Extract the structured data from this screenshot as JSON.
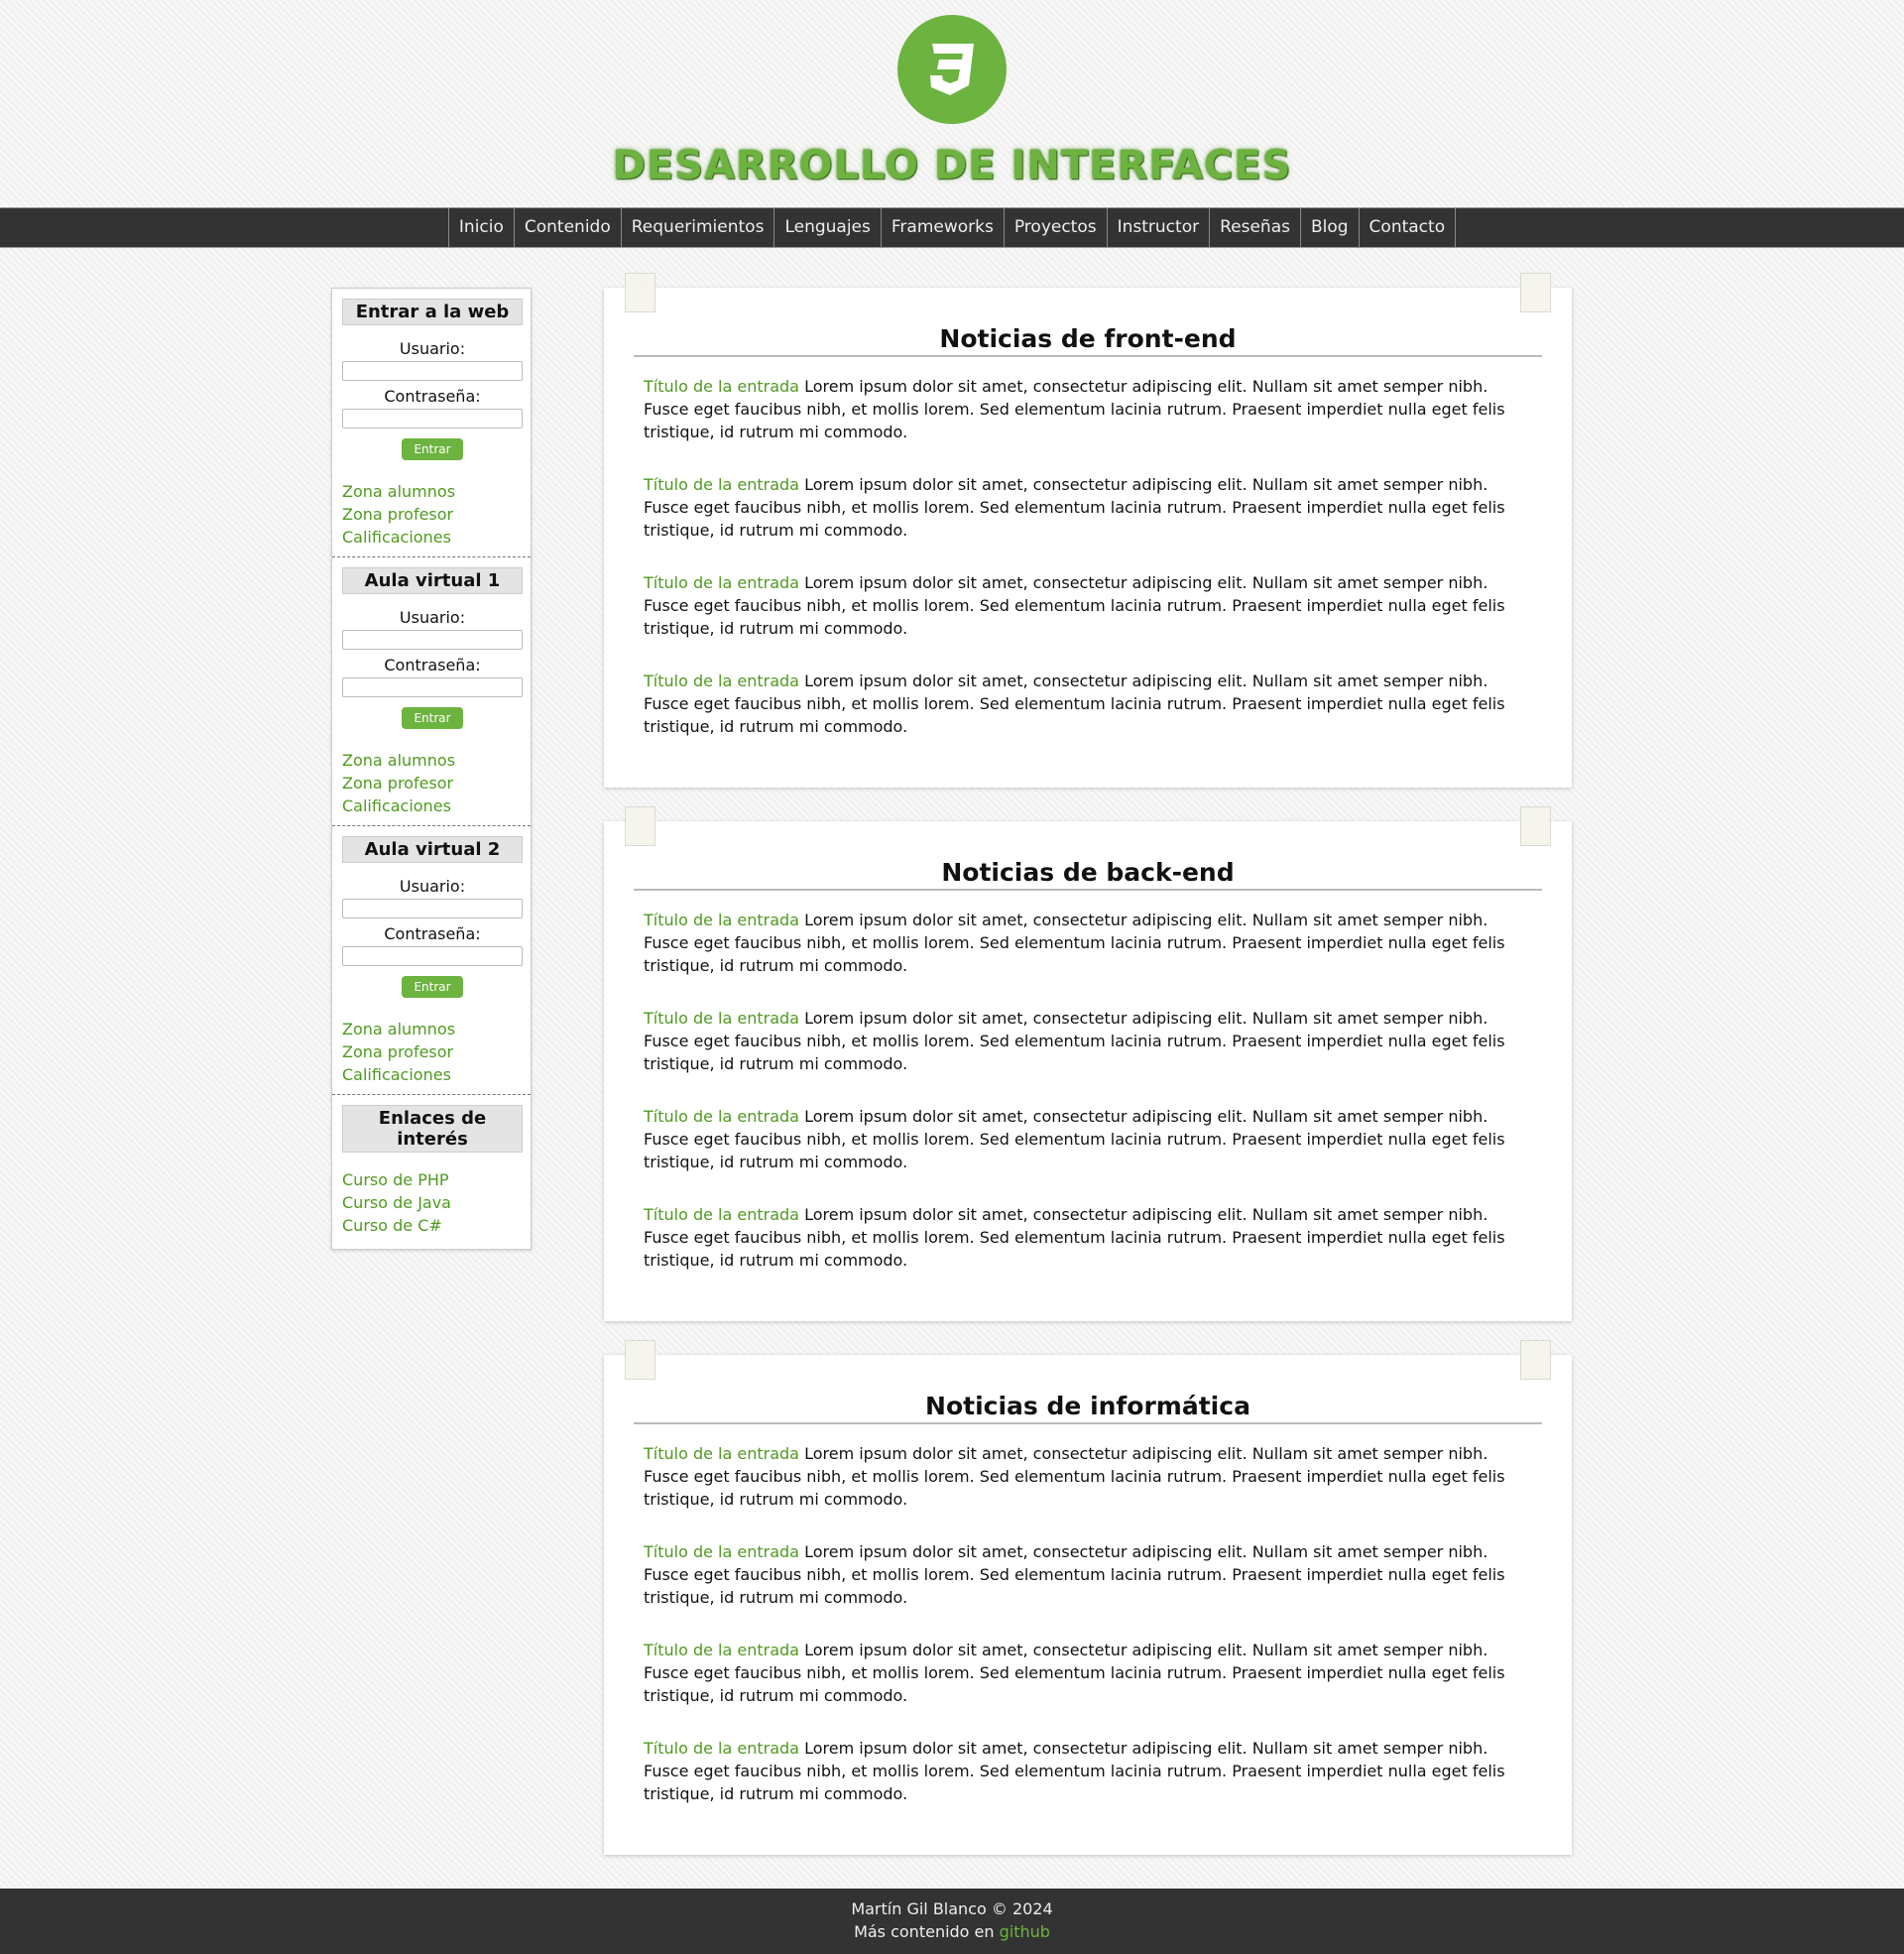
{
  "header": {
    "title": "DESARROLLO DE INTERFACES",
    "logo_icon": "css3-icon",
    "accent": "#6db33f"
  },
  "nav": [
    "Inicio",
    "Contenido",
    "Requerimientos",
    "Lenguajes",
    "Frameworks",
    "Proyectos",
    "Instructor",
    "Reseñas",
    "Blog",
    "Contacto"
  ],
  "sidebar": {
    "sections": [
      {
        "heading": "Entrar a la web",
        "user_label": "Usuario:",
        "pass_label": "Contraseña:",
        "button": "Entrar",
        "links": [
          "Zona alumnos",
          "Zona profesor",
          "Calificaciones"
        ]
      },
      {
        "heading": "Aula virtual 1",
        "user_label": "Usuario:",
        "pass_label": "Contraseña:",
        "button": "Entrar",
        "links": [
          "Zona alumnos",
          "Zona profesor",
          "Calificaciones"
        ]
      },
      {
        "heading": "Aula virtual 2",
        "user_label": "Usuario:",
        "pass_label": "Contraseña:",
        "button": "Entrar",
        "links": [
          "Zona alumnos",
          "Zona profesor",
          "Calificaciones"
        ]
      }
    ],
    "interest": {
      "heading": "Enlaces de interés",
      "links": [
        "Curso de PHP",
        "Curso de Java",
        "Curso de C#"
      ]
    }
  },
  "panels": [
    {
      "title": "Noticias de front-end",
      "entries": [
        {
          "title": "Título de la entrada",
          "text": " Lorem ipsum dolor sit amet, consectetur adipiscing elit. Nullam sit amet semper nibh. Fusce eget faucibus nibh, et mollis lorem. Sed elementum lacinia rutrum. Praesent imperdiet nulla eget felis tristique, id rutrum mi commodo."
        },
        {
          "title": "Título de la entrada",
          "text": " Lorem ipsum dolor sit amet, consectetur adipiscing elit. Nullam sit amet semper nibh. Fusce eget faucibus nibh, et mollis lorem. Sed elementum lacinia rutrum. Praesent imperdiet nulla eget felis tristique, id rutrum mi commodo."
        },
        {
          "title": "Título de la entrada",
          "text": " Lorem ipsum dolor sit amet, consectetur adipiscing elit. Nullam sit amet semper nibh. Fusce eget faucibus nibh, et mollis lorem. Sed elementum lacinia rutrum. Praesent imperdiet nulla eget felis tristique, id rutrum mi commodo."
        },
        {
          "title": "Título de la entrada",
          "text": " Lorem ipsum dolor sit amet, consectetur adipiscing elit. Nullam sit amet semper nibh. Fusce eget faucibus nibh, et mollis lorem. Sed elementum lacinia rutrum. Praesent imperdiet nulla eget felis tristique, id rutrum mi commodo."
        }
      ]
    },
    {
      "title": "Noticias de back-end",
      "entries": [
        {
          "title": "Título de la entrada",
          "text": " Lorem ipsum dolor sit amet, consectetur adipiscing elit. Nullam sit amet semper nibh. Fusce eget faucibus nibh, et mollis lorem. Sed elementum lacinia rutrum. Praesent imperdiet nulla eget felis tristique, id rutrum mi commodo."
        },
        {
          "title": "Título de la entrada",
          "text": " Lorem ipsum dolor sit amet, consectetur adipiscing elit. Nullam sit amet semper nibh. Fusce eget faucibus nibh, et mollis lorem. Sed elementum lacinia rutrum. Praesent imperdiet nulla eget felis tristique, id rutrum mi commodo."
        },
        {
          "title": "Título de la entrada",
          "text": " Lorem ipsum dolor sit amet, consectetur adipiscing elit. Nullam sit amet semper nibh. Fusce eget faucibus nibh, et mollis lorem. Sed elementum lacinia rutrum. Praesent imperdiet nulla eget felis tristique, id rutrum mi commodo."
        },
        {
          "title": "Título de la entrada",
          "text": " Lorem ipsum dolor sit amet, consectetur adipiscing elit. Nullam sit amet semper nibh. Fusce eget faucibus nibh, et mollis lorem. Sed elementum lacinia rutrum. Praesent imperdiet nulla eget felis tristique, id rutrum mi commodo."
        }
      ]
    },
    {
      "title": "Noticias de informática",
      "entries": [
        {
          "title": "Título de la entrada",
          "text": " Lorem ipsum dolor sit amet, consectetur adipiscing elit. Nullam sit amet semper nibh. Fusce eget faucibus nibh, et mollis lorem. Sed elementum lacinia rutrum. Praesent imperdiet nulla eget felis tristique, id rutrum mi commodo."
        },
        {
          "title": "Título de la entrada",
          "text": " Lorem ipsum dolor sit amet, consectetur adipiscing elit. Nullam sit amet semper nibh. Fusce eget faucibus nibh, et mollis lorem. Sed elementum lacinia rutrum. Praesent imperdiet nulla eget felis tristique, id rutrum mi commodo."
        },
        {
          "title": "Título de la entrada",
          "text": " Lorem ipsum dolor sit amet, consectetur adipiscing elit. Nullam sit amet semper nibh. Fusce eget faucibus nibh, et mollis lorem. Sed elementum lacinia rutrum. Praesent imperdiet nulla eget felis tristique, id rutrum mi commodo."
        },
        {
          "title": "Título de la entrada",
          "text": " Lorem ipsum dolor sit amet, consectetur adipiscing elit. Nullam sit amet semper nibh. Fusce eget faucibus nibh, et mollis lorem. Sed elementum lacinia rutrum. Praesent imperdiet nulla eget felis tristique, id rutrum mi commodo."
        }
      ]
    }
  ],
  "footer": {
    "copyright": "Martín Gil Blanco © 2024",
    "more_prefix": "Más contenido en ",
    "more_link": "github"
  }
}
